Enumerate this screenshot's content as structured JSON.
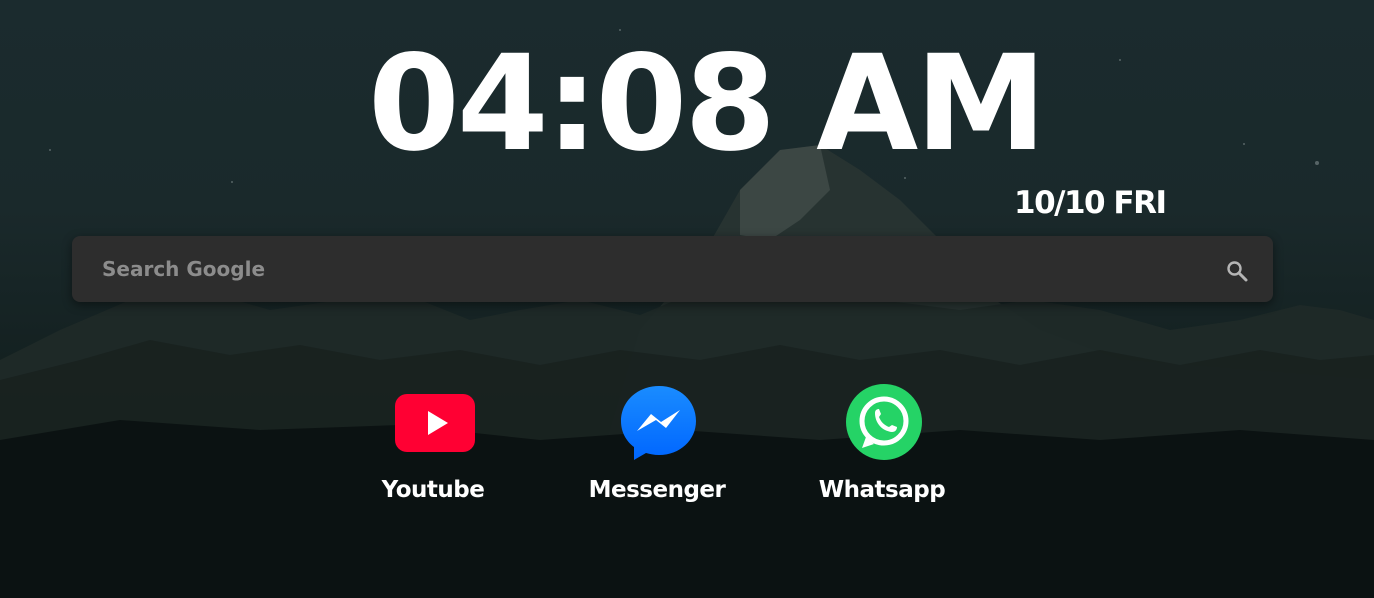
{
  "clock": {
    "time": "04:08 AM",
    "date": "10/10 FRI"
  },
  "search": {
    "placeholder": "Search Google",
    "icon": "search-icon"
  },
  "shortcuts": [
    {
      "label": "Youtube",
      "icon": "youtube-icon",
      "color": "#ff0033"
    },
    {
      "label": "Messenger",
      "icon": "messenger-icon",
      "color": "#0a7cff"
    },
    {
      "label": "Whatsapp",
      "icon": "whatsapp-icon",
      "color": "#25d366"
    }
  ],
  "theme": {
    "background": "#1b2b2e",
    "search_bar": "#2d2d2d",
    "text": "#ffffff"
  }
}
